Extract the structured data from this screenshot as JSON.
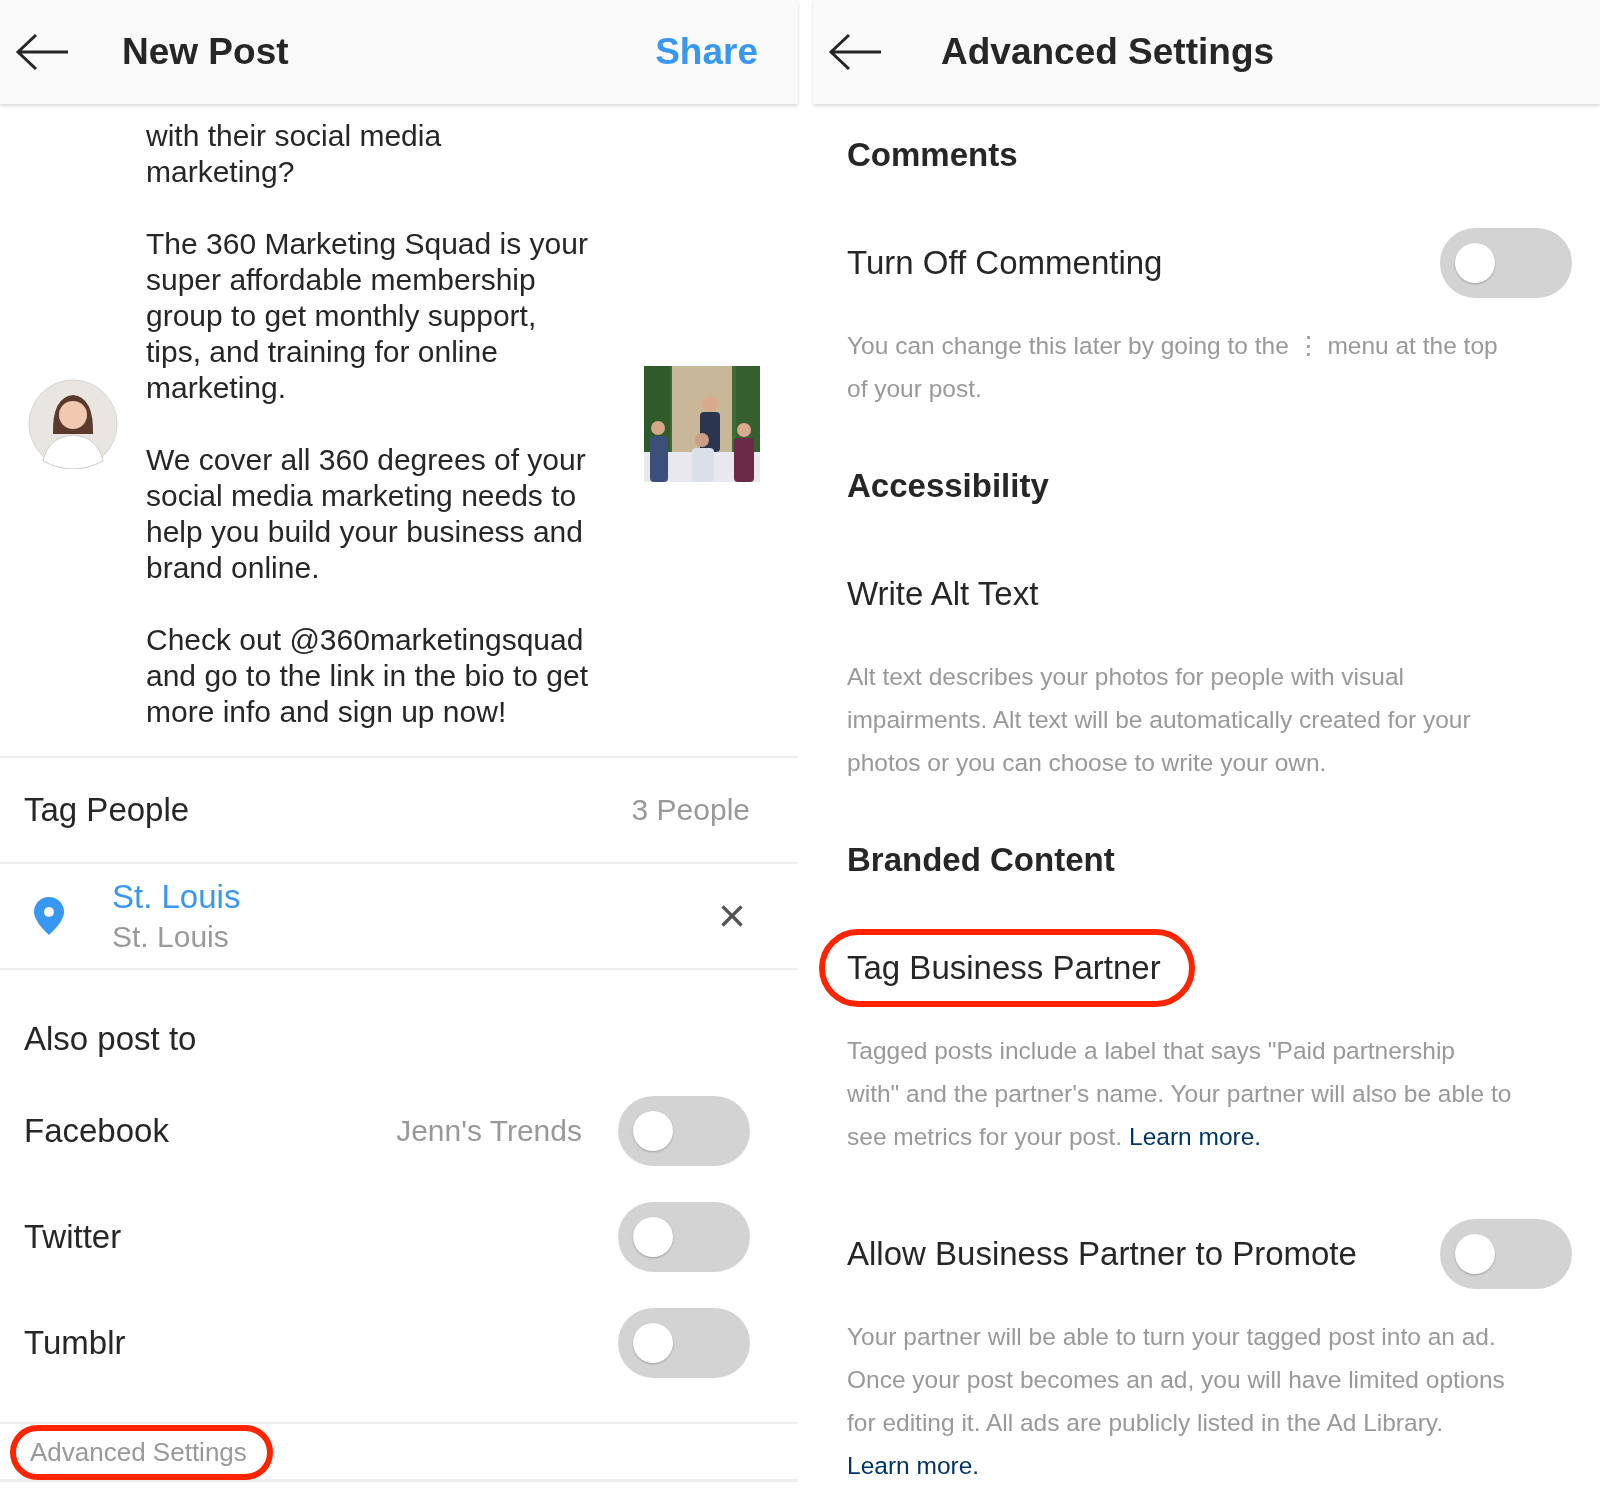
{
  "new_post": {
    "title": "New Post",
    "share": "Share",
    "caption": [
      "with their social media\nmarketing?",
      "The 360 Marketing Squad is your\nsuper affordable membership\ngroup to get monthly support,\ntips, and training for online\nmarketing.",
      "We cover all 360 degrees of your\nsocial media marketing needs to\nhelp you build your business and\nbrand online.",
      "Check out @360marketingsquad\nand go to the link in the bio to get\nmore info and sign up now!"
    ],
    "tag_people": {
      "label": "Tag People",
      "value": "3 People"
    },
    "location": {
      "name": "St. Louis",
      "detail": "St. Louis",
      "remove": "×"
    },
    "also_post_to": "Also post to",
    "networks": [
      {
        "name": "Facebook",
        "account": "Jenn's Trends",
        "on": false
      },
      {
        "name": "Twitter",
        "on": false
      },
      {
        "name": "Tumblr",
        "on": false
      }
    ],
    "advanced": {
      "label": "Advanced Settings",
      "highlighted": true
    }
  },
  "advanced_settings": {
    "title": "Advanced Settings",
    "sections": [
      {
        "heading": "Comments",
        "items": [
          {
            "label": "Turn Off Commenting",
            "kind": "toggle",
            "on": false,
            "highlighted": false,
            "description": "You can change this later by going to the ⋮ menu at the top\nof your post."
          }
        ]
      },
      {
        "heading": "Accessibility",
        "items": [
          {
            "label": "Write Alt Text",
            "kind": "link",
            "highlighted": false,
            "description": "Alt text describes your photos for people with visual\nimpairments. Alt text will be automatically created for your\nphotos or you can choose to write your own."
          }
        ]
      },
      {
        "heading": "Branded Content",
        "items": [
          {
            "label": "Tag Business Partner",
            "kind": "link",
            "highlighted": true,
            "description": "Tagged posts include a label that says \"Paid partnership\nwith\" and the partner's name. Your partner will also be able to\nsee metrics for your post.",
            "learn_more": "Learn more.",
            "learn_more_own_line": false
          },
          {
            "label": "Allow Business Partner to Promote",
            "kind": "toggle",
            "on": false,
            "highlighted": false,
            "description": "Your partner will be able to turn your tagged post into an ad.\nOnce your post becomes an ad, you will have limited options\nfor editing it. All ads are publicly listed in the Ad Library.",
            "learn_more": "Learn more.",
            "learn_more_own_line": true
          }
        ]
      }
    ]
  }
}
